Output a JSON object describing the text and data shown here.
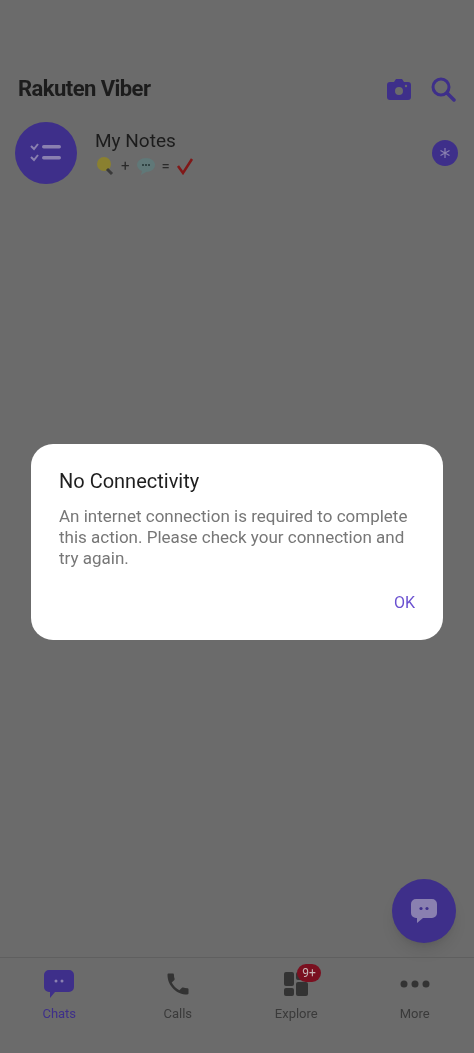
{
  "header": {
    "logo": "Rakuten Viber"
  },
  "chats": [
    {
      "name": "My Notes",
      "plus": "+",
      "equals": "=",
      "pinned": true
    }
  ],
  "dialog": {
    "title": "No Connectivity",
    "message": "An internet connection is required to complete this action. Please check your connection and try again.",
    "button": "OK"
  },
  "nav": [
    {
      "kind": "chats",
      "label": "Chats",
      "selected": true
    },
    {
      "kind": "calls",
      "label": "Calls",
      "selected": false
    },
    {
      "kind": "explore",
      "label": "Explore",
      "selected": false,
      "badge": "9+"
    },
    {
      "kind": "more",
      "label": "More",
      "selected": false
    }
  ]
}
